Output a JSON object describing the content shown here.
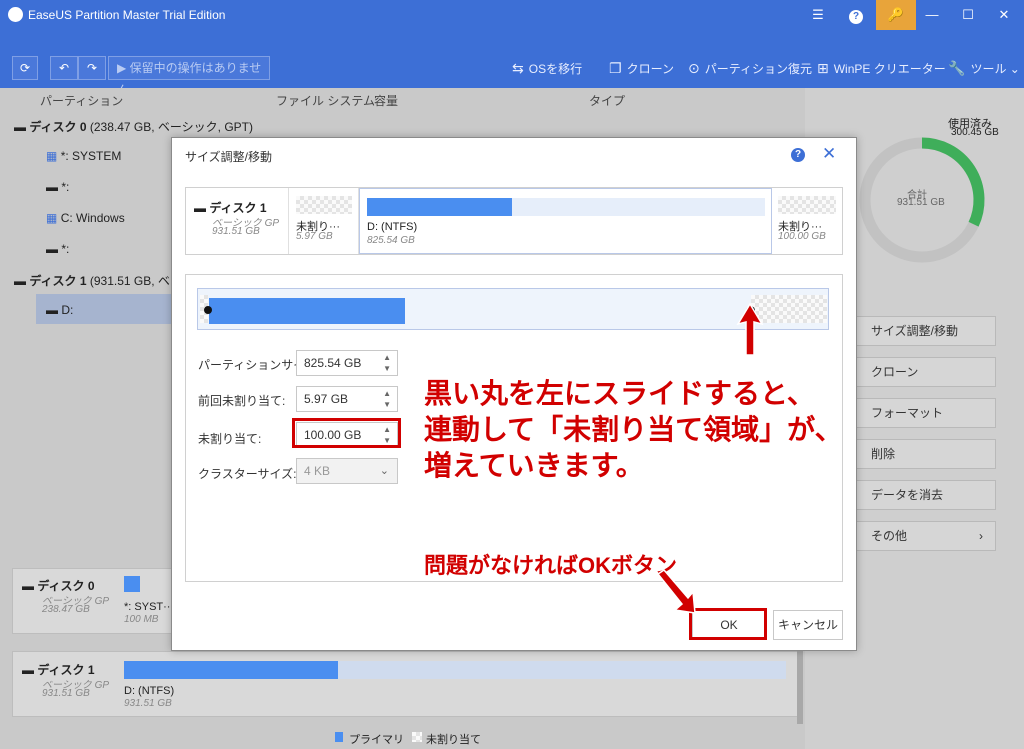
{
  "app": {
    "title": "EaseUS Partition Master Trial Edition"
  },
  "toolbar": {
    "pending_label": "保留中の操作はありません",
    "os_migrate": "OSを移行",
    "clone": "クローン",
    "partition_recovery": "パーティション復元",
    "winpe": "WinPE クリエーター",
    "tools": "ツール"
  },
  "columns": [
    "パーティション",
    "ファイル システム",
    "容量",
    "タイプ"
  ],
  "tree": {
    "disk0_name": "ディスク 0",
    "disk0_info": "(238.47 GB, ベーシック, GPT)",
    "disk0_parts": [
      "*: SYSTEM",
      "*:",
      "C: Windows",
      "*:"
    ],
    "disk1_name": "ディスク 1",
    "disk1_info": "(931.51 GB, ベ",
    "disk1_parts": [
      "D:"
    ]
  },
  "right": {
    "used_label": "使用済み",
    "used_value": "300.45 GB",
    "total_label": "合計",
    "total_value": "931.51 GB",
    "used_fraction": 0.32,
    "actions": [
      "サイズ調整/移動",
      "クローン",
      "フォーマット",
      "削除",
      "データを消去",
      "その他"
    ]
  },
  "bottom": {
    "disk0": {
      "name": "ディスク 0",
      "type": "ベーシック GP",
      "size": "238.47 GB",
      "part_label": "*: SYST···",
      "part_size": "100 MB"
    },
    "disk1": {
      "name": "ディスク 1",
      "type": "ベーシック GP",
      "size": "931.51 GB",
      "part_label": "D: (NTFS)",
      "part_size": "931.51 GB"
    },
    "legend_primary": "プライマリ",
    "legend_unalloc": "未割り当て"
  },
  "dialog": {
    "title": "サイズ調整/移動",
    "strip": {
      "disk_name": "ディスク 1",
      "disk_type": "ベーシック GP",
      "disk_size": "931.51 GB",
      "left_label": "未割り···",
      "left_size": "5.97 GB",
      "part_label": "D: (NTFS)",
      "part_size": "825.54 GB",
      "right_label": "未割り···",
      "right_size": "100.00 GB"
    },
    "fields": {
      "partition_size_label": "パーティションサイズ:",
      "partition_size": "825.54 GB",
      "before_label": "前回未割り当て:",
      "before_value": "5.97 GB",
      "unalloc_label": "未割り当て:",
      "unalloc_value": "100.00 GB",
      "cluster_label": "クラスターサイズ:",
      "cluster_value": "4 KB"
    },
    "ok": "OK",
    "cancel": "キャンセル"
  },
  "annotations": {
    "line1": "黒い丸を左にスライドすると、",
    "line2": "連動して「未割り当て領域」が、",
    "line3": "増えていきます。",
    "ok_hint": "問題がなければOKボタン"
  },
  "colors": {
    "accent": "#3d6fd6",
    "bar": "#4a8ef0",
    "annotation": "#d10000",
    "used_ring": "#3fae5a"
  }
}
